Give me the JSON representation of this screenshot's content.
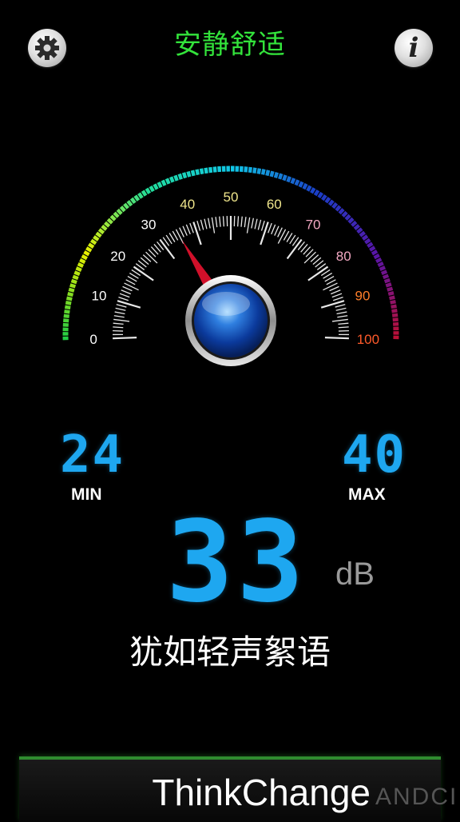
{
  "header": {
    "title": "安静舒适",
    "settings_icon": "gear-icon",
    "info_icon": "info-icon",
    "info_glyph": "i"
  },
  "gauge": {
    "min": 0,
    "max": 100,
    "major_labels": [
      "0",
      "10",
      "20",
      "30",
      "40",
      "50",
      "60",
      "70",
      "80",
      "90",
      "100"
    ],
    "label_colors": [
      "#ffffff",
      "#ffffff",
      "#ffffff",
      "#ffffff",
      "#f0e68c",
      "#f0e68c",
      "#f0e68c",
      "#f4a9c4",
      "#f4a9c4",
      "#ff7f2a",
      "#ff5a2a"
    ],
    "needle_value": 33,
    "arc_colors": [
      "#22cc44",
      "#e8f000",
      "#22dd99",
      "#10c7e8",
      "#1a3ec8",
      "#5a14a6",
      "#c01030"
    ]
  },
  "stats": {
    "min_value": "24",
    "min_label": "MIN",
    "max_value": "40",
    "max_label": "MAX",
    "current_value": "33",
    "unit": "dB"
  },
  "description": "犹如轻声絮语",
  "footer": {
    "brand": "ThinkChange",
    "watermark": "ANDCI"
  },
  "colors": {
    "title": "#33e33b",
    "digits": "#1ea7f0",
    "needle": "#d0102a"
  }
}
